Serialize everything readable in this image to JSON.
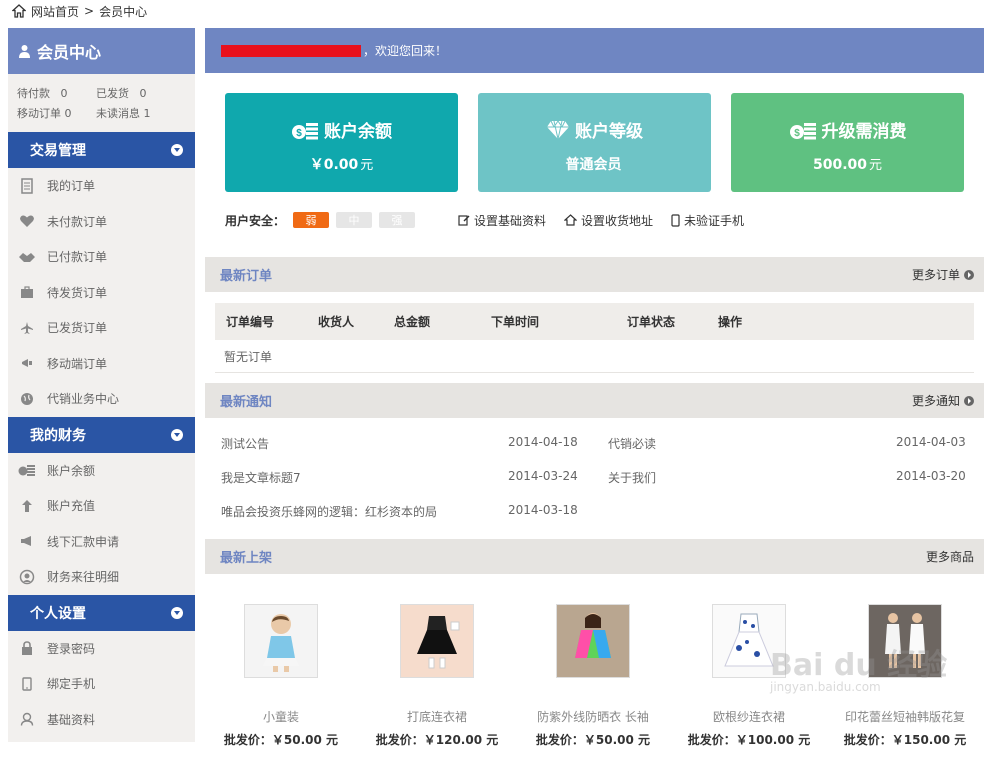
{
  "breadcrumb": {
    "home": "网站首页",
    "sep": ">",
    "current": "会员中心"
  },
  "sidebar": {
    "title": "会员中心",
    "stats": [
      [
        {
          "label": "待付款",
          "value": "0"
        },
        {
          "label": "已发货",
          "value": "0"
        }
      ],
      [
        {
          "label": "移动订单",
          "value": "0"
        },
        {
          "label": "未读消息",
          "value": "1"
        }
      ]
    ],
    "sections": [
      {
        "title": "交易管理",
        "items": [
          "我的订单",
          "未付款订单",
          "已付款订单",
          "待发货订单",
          "已发货订单",
          "移动端订单",
          "代销业务中心"
        ]
      },
      {
        "title": "我的财务",
        "items": [
          "账户余额",
          "账户充值",
          "线下汇款申请",
          "财务来往明细"
        ]
      },
      {
        "title": "个人设置",
        "items": [
          "登录密码",
          "绑定手机",
          "基础资料"
        ]
      }
    ]
  },
  "welcome": {
    "text": "，欢迎您回来！"
  },
  "cards": [
    {
      "title": "账户余额",
      "value": "￥0.00",
      "unit": "元",
      "color": "#10a8ad",
      "icon": "coins-icon"
    },
    {
      "title": "账户等级",
      "value": "普通会员",
      "unit": "",
      "color": "#6ec4c6",
      "icon": "diamond-icon"
    },
    {
      "title": "升级需消费",
      "value": "500.00",
      "unit": "元",
      "color": "#5fc181",
      "icon": "coins-icon"
    }
  ],
  "security": {
    "label": "用户安全：",
    "levels": [
      "弱",
      "中",
      "强"
    ],
    "links": [
      "设置基础资料",
      "设置收货地址",
      "未验证手机"
    ]
  },
  "orders": {
    "title": "最新订单",
    "more": "更多订单",
    "columns": [
      "订单编号",
      "收货人",
      "总金额",
      "下单时间",
      "订单状态",
      "操作"
    ],
    "empty": "暂无订单"
  },
  "notices": {
    "title": "最新通知",
    "more": "更多通知",
    "items": [
      {
        "title": "测试公告",
        "date": "2014-04-18"
      },
      {
        "title": "代销必读",
        "date": "2014-04-03"
      },
      {
        "title": "我是文章标题7",
        "date": "2014-03-24"
      },
      {
        "title": "关于我们",
        "date": "2014-03-20"
      },
      {
        "title": "唯品会投资乐蜂网的逻辑：红杉资本的局",
        "date": "2014-03-18"
      }
    ]
  },
  "products": {
    "title": "最新上架",
    "more": "更多商品",
    "items": [
      {
        "name": "小童装",
        "price": "批发价：￥50.00 元"
      },
      {
        "name": "打底连衣裙",
        "price": "批发价：￥120.00 元"
      },
      {
        "name": "防紫外线防晒衣 长袖",
        "price": "批发价：￥50.00 元"
      },
      {
        "name": "欧根纱连衣裙",
        "price": "批发价：￥100.00 元"
      },
      {
        "name": "印花蕾丝短袖韩版花复",
        "price": "批发价：￥150.00 元"
      }
    ]
  },
  "watermark": {
    "text": "Bai du 经验",
    "sub": "jingyan.baidu.com"
  }
}
